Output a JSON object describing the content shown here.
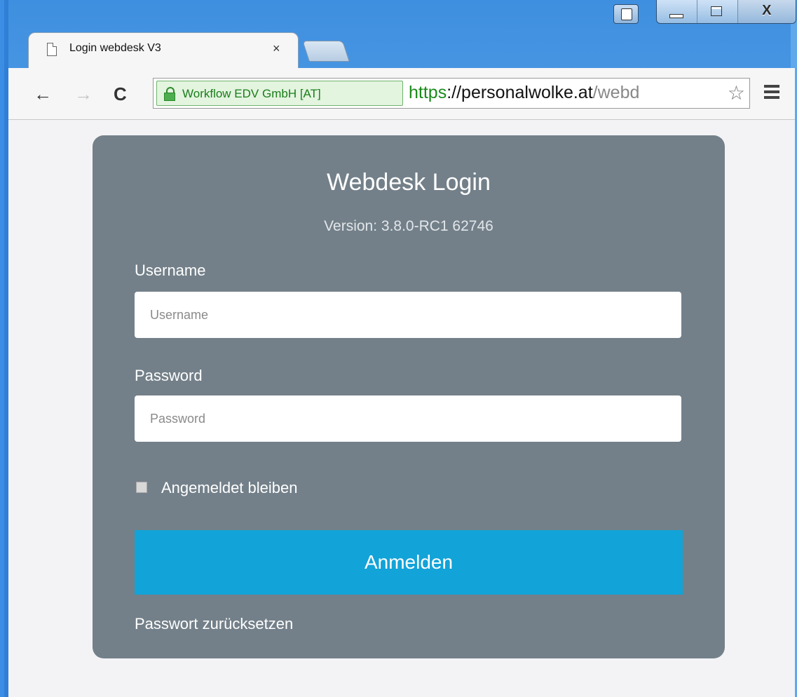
{
  "browser": {
    "tab": {
      "title": "Login webdesk V3",
      "close_glyph": "×"
    },
    "nav": {
      "back_glyph": "←",
      "forward_glyph": "→",
      "reload_glyph": "C"
    },
    "ev_certificate": "Workflow EDV GmbH [AT]",
    "url": {
      "scheme": "https",
      "separator": "://",
      "host": "personalwolke.at",
      "path": "/webd"
    },
    "bookmark_glyph": "☆",
    "window_controls": {
      "close_glyph": "X"
    }
  },
  "login": {
    "title": "Webdesk Login",
    "version": "Version: 3.8.0-RC1 62746",
    "username_label": "Username",
    "username_placeholder": "Username",
    "username_value": "",
    "password_label": "Password",
    "password_placeholder": "Password",
    "password_value": "",
    "remember_label": "Angemeldet bleiben",
    "remember_checked": false,
    "submit_label": "Anmelden",
    "reset_link": "Passwort zurücksetzen"
  },
  "colors": {
    "card_bg": "#738089",
    "button_bg": "#12a3d8",
    "ev_green": "#1a7d1a",
    "page_bg": "#f3f3f6"
  },
  "icons": [
    "page-icon",
    "close-icon",
    "back-arrow-icon",
    "forward-arrow-icon",
    "reload-icon",
    "lock-icon",
    "star-icon",
    "menu-icon",
    "profile-icon",
    "minimize-icon",
    "maximize-icon",
    "window-close-icon"
  ]
}
